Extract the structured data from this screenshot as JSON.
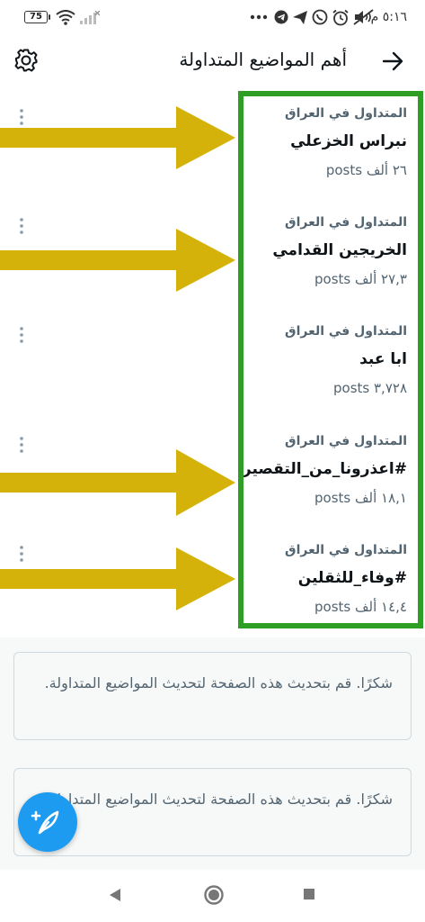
{
  "status_bar": {
    "battery": "75",
    "time": "٥:١٦ م"
  },
  "header": {
    "title": "أهم المواضيع المتداولة"
  },
  "trends": [
    {
      "context": "المتداول في العراق",
      "name": "نبراس الخزعلي",
      "count": "٢٦ ألف posts"
    },
    {
      "context": "المتداول في العراق",
      "name": "الخريجين القدامي",
      "count": "٢٧,٣ ألف posts"
    },
    {
      "context": "المتداول في العراق",
      "name": "ابا عبد",
      "count": "٣,٧٢٨ posts"
    },
    {
      "context": "المتداول في العراق",
      "name": "#اعذرونا_من_التقصير",
      "count": "١٨,١ ألف posts"
    },
    {
      "context": "المتداول في العراق",
      "name": "#وفاء_للثقلين",
      "count": "١٤,٤ ألف posts"
    }
  ],
  "notices": [
    {
      "text": "شكرًا. قم بتحديث هذه الصفحة لتحديث المواضيع المتداولة."
    },
    {
      "text": "شكرًا. قم بتحديث هذه الصفحة لتحديث المواضيع المتداولة."
    }
  ],
  "colors": {
    "accent": "#1d9bf0",
    "highlight_box": "#2e9e24",
    "arrow": "#d4b20a"
  }
}
